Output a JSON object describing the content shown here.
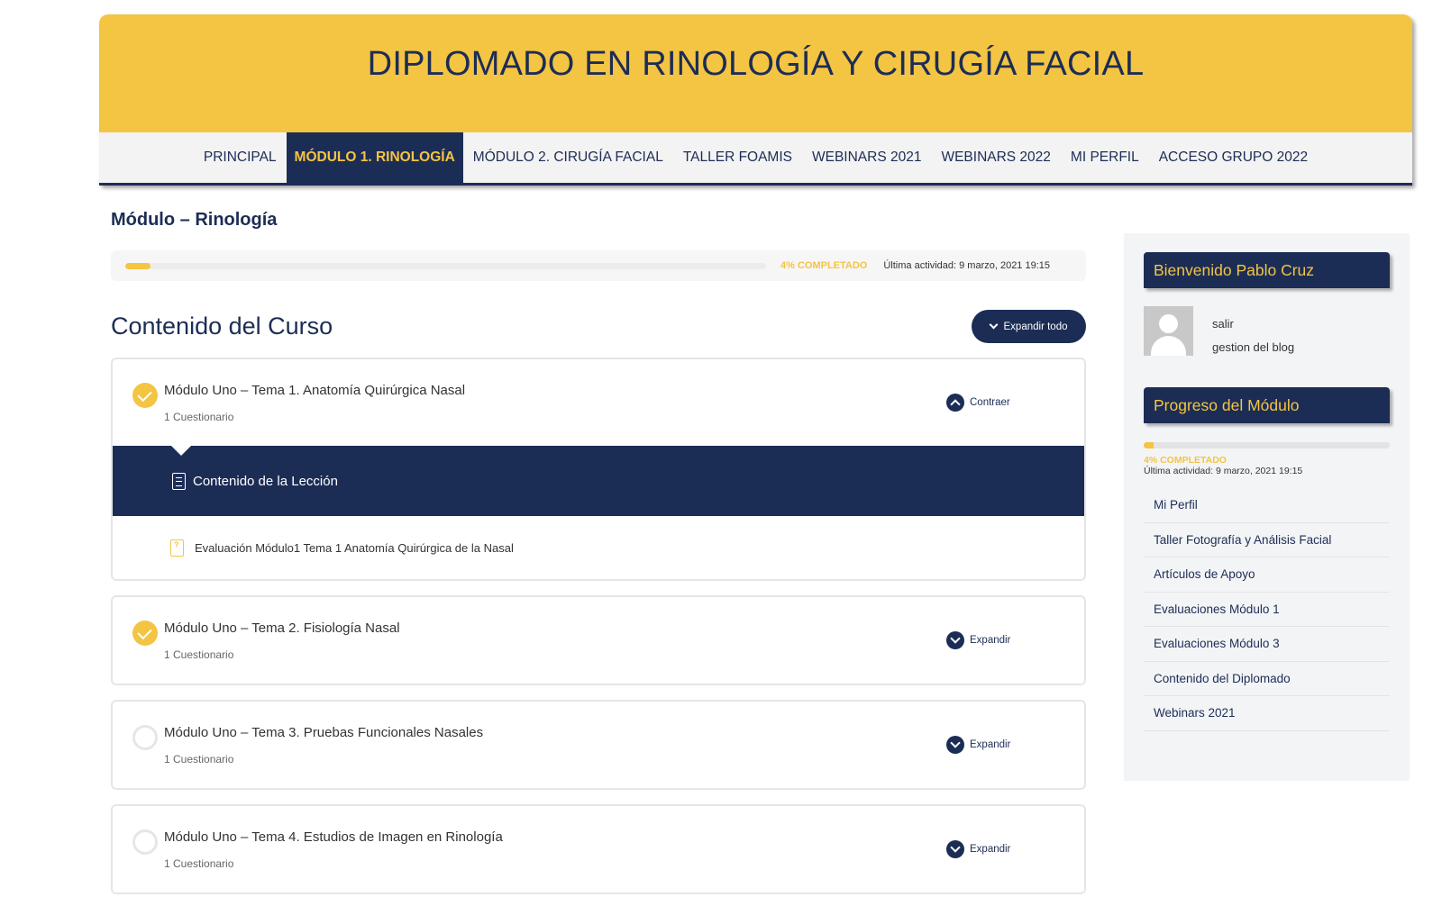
{
  "header": {
    "site_title": "DIPLOMADO EN RINOLOGÍA Y CIRUGÍA FACIAL",
    "nav": [
      {
        "label": "PRINCIPAL",
        "active": false
      },
      {
        "label": "MÓDULO 1. RINOLOGÍA",
        "active": true
      },
      {
        "label": "MÓDULO 2. CIRUGÍA FACIAL",
        "active": false
      },
      {
        "label": "TALLER FOAMIS",
        "active": false
      },
      {
        "label": "WEBINARS 2021",
        "active": false
      },
      {
        "label": "WEBINARS 2022",
        "active": false
      },
      {
        "label": "MI PERFIL",
        "active": false
      },
      {
        "label": "ACCESO GRUPO 2022",
        "active": false
      }
    ]
  },
  "main": {
    "page_title": "Módulo – Rinología",
    "progress": {
      "percent": 4,
      "label": "4% COMPLETADO",
      "last_activity": "Última actividad: 9 marzo, 2021 19:15"
    },
    "content_title": "Contenido del Curso",
    "expand_all_label": "Expandir todo",
    "lessons": [
      {
        "title": "Módulo Uno – Tema 1. Anatomía Quirúrgica Nasal",
        "meta": "1 Cuestionario",
        "completed": true,
        "toggle_label": "Contraer",
        "expanded": true,
        "content_label": "Contenido de la Lección",
        "quiz_title": "Evaluación Módulo1 Tema 1 Anatomía Quirúrgica de la Nasal"
      },
      {
        "title": "Módulo Uno – Tema 2. Fisiología Nasal",
        "meta": "1 Cuestionario",
        "completed": true,
        "toggle_label": "Expandir",
        "expanded": false
      },
      {
        "title": "Módulo Uno – Tema 3. Pruebas Funcionales Nasales",
        "meta": "1 Cuestionario",
        "completed": false,
        "toggle_label": "Expandir",
        "expanded": false
      },
      {
        "title": "Módulo Uno – Tema 4. Estudios de Imagen en Rinología",
        "meta": "1 Cuestionario",
        "completed": false,
        "toggle_label": "Expandir",
        "expanded": false
      }
    ]
  },
  "sidebar": {
    "welcome_title": "Bienvenido Pablo Cruz",
    "user_links": [
      "salir",
      "gestion del blog"
    ],
    "progress_title": "Progreso del Módulo",
    "progress": {
      "percent": 4,
      "label": "4% COMPLETADO",
      "last_activity": "Última actividad: 9 marzo, 2021 19:15"
    },
    "menu": [
      "Mi Perfil",
      "Taller Fotografía y Análisis Facial",
      "Artículos de Apoyo",
      "Evaluaciones Módulo 1",
      "Evaluaciones Módulo 3",
      "Contenido del Diplomado",
      "Webinars 2021"
    ]
  },
  "colors": {
    "brand_navy": "#1c2d55",
    "brand_yellow": "#f4c443"
  }
}
